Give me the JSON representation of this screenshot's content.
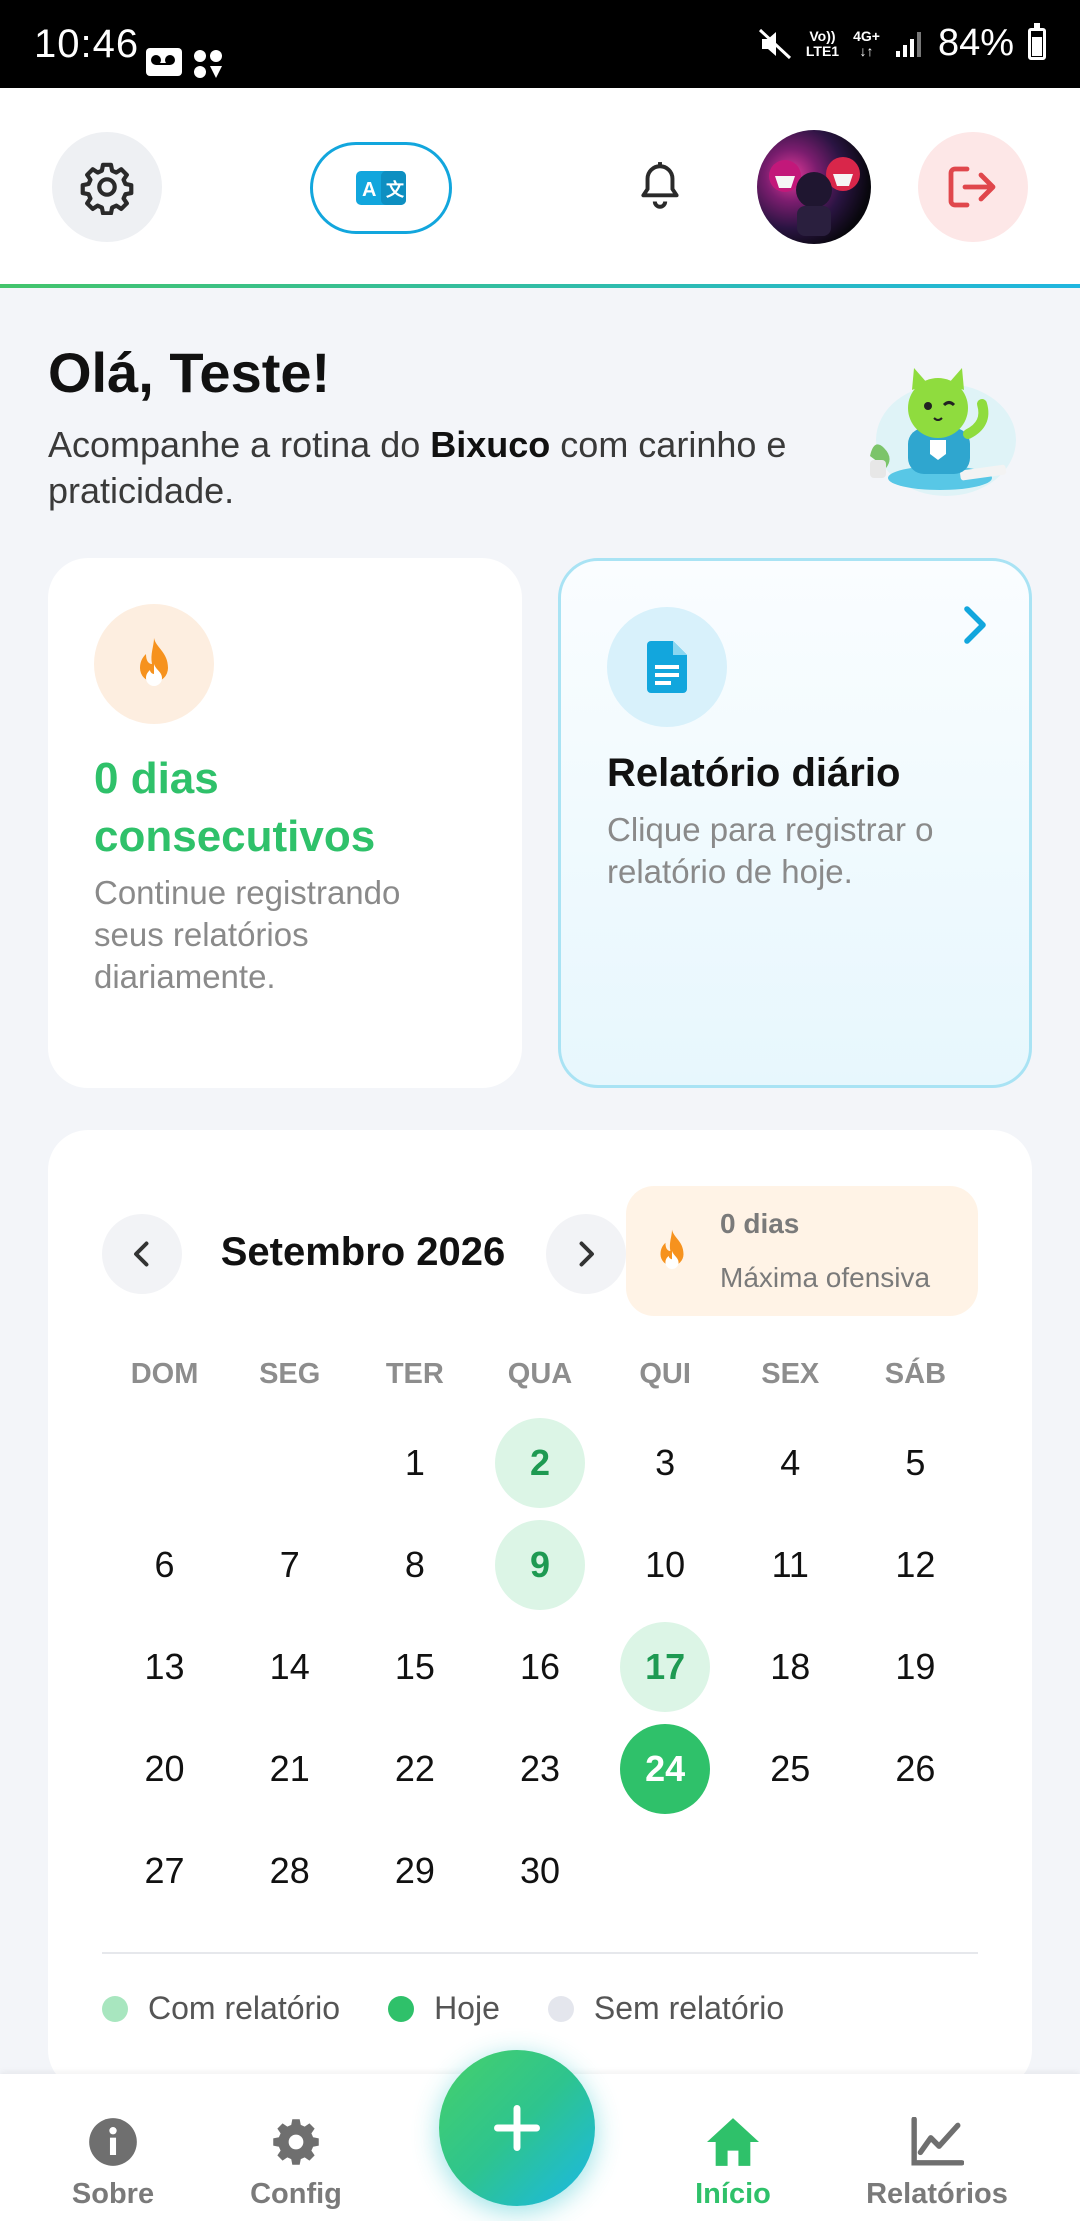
{
  "status_bar": {
    "time": "10:46",
    "network_top": "Vo))",
    "network_bottom": "LTE1",
    "network_type": "4G+",
    "battery": "84%"
  },
  "header": {
    "icons": [
      "gear-icon",
      "translate-icon",
      "bell-icon",
      "logout-icon"
    ]
  },
  "greeting": {
    "title": "Olá, Teste!",
    "sub_prefix": "Acompanhe a rotina do ",
    "pet_name": "Bixuco",
    "sub_suffix": " com carinho e praticidade."
  },
  "streak_card": {
    "title": "0 dias consecutivos",
    "description": "Continue registrando seus relatórios diariamente."
  },
  "report_card": {
    "title": "Relatório diário",
    "description": "Clique para registrar o relatório de hoje."
  },
  "calendar": {
    "month": "Setembro 2026",
    "max_streak_value": "0 dias",
    "max_streak_label": "Máxima ofensiva",
    "weekdays": [
      "DOM",
      "SEG",
      "TER",
      "QUA",
      "QUI",
      "SEX",
      "SÁB"
    ],
    "leading_blank_days": 2,
    "days": [
      "1",
      "2",
      "3",
      "4",
      "5",
      "6",
      "7",
      "8",
      "9",
      "10",
      "11",
      "12",
      "13",
      "14",
      "15",
      "16",
      "17",
      "18",
      "19",
      "20",
      "21",
      "22",
      "23",
      "24",
      "25",
      "26",
      "27",
      "28",
      "29",
      "30"
    ],
    "reported_days": [
      "2",
      "9",
      "17"
    ],
    "today": "24",
    "legend": {
      "with_report": "Com relatório",
      "today": "Hoje",
      "without_report": "Sem relatório"
    }
  },
  "bottom_nav": {
    "items": [
      {
        "label": "Sobre",
        "icon": "info-icon"
      },
      {
        "label": "Config",
        "icon": "gear-icon"
      },
      {
        "label": "Início",
        "icon": "home-icon"
      },
      {
        "label": "Relatórios",
        "icon": "chart-icon"
      }
    ],
    "active": "Início",
    "fab_icon": "plus-icon"
  },
  "colors": {
    "accent_green": "#2fc16a",
    "accent_blue": "#12a6dd",
    "streak_orange": "#f6921e",
    "logout_red": "#e0474c"
  }
}
